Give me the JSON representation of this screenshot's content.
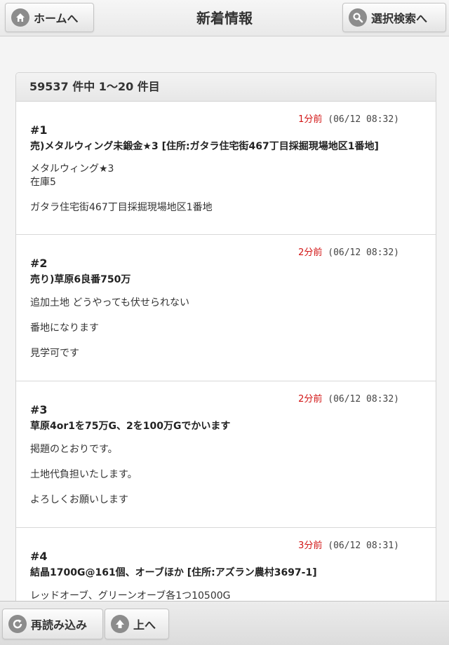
{
  "header": {
    "title": "新着情報",
    "home_label": "ホームへ",
    "search_label": "選択検索へ"
  },
  "results": {
    "summary": "59537 件中 1～20 件目"
  },
  "items": [
    {
      "num": "#1",
      "ago": "1分前",
      "ts": "(06/12 08:32)",
      "title": "売)メタルウィング未鍛金★3 [住所:ガタラ住宅街467丁目採掘現場地区1番地]",
      "lines": [
        "メタルウィング★3",
        "在庫5",
        "ガタラ住宅街467丁目採掘現場地区1番地"
      ]
    },
    {
      "num": "#2",
      "ago": "2分前",
      "ts": "(06/12 08:32)",
      "title": "売り)草原6良番750万",
      "lines": [
        "追加土地 どうやっても伏せられない",
        "番地になります",
        "見学可です"
      ]
    },
    {
      "num": "#3",
      "ago": "2分前",
      "ts": "(06/12 08:32)",
      "title": "草原4or1を75万G、2を100万Gでかいます",
      "lines": [
        "掲題のとおりです。",
        "土地代負担いたします。",
        "よろしくお願いします"
      ]
    },
    {
      "num": "#4",
      "ago": "3分前",
      "ts": "(06/12 08:31)",
      "title": "結晶1700G@161個、オーブほか [住所:アズラン農村3697-1]",
      "lines": [
        "レッドオーブ、グリーンオーブ各1つ10500G"
      ]
    }
  ],
  "footer": {
    "reload_label": "再読み込み",
    "up_label": "上へ"
  }
}
